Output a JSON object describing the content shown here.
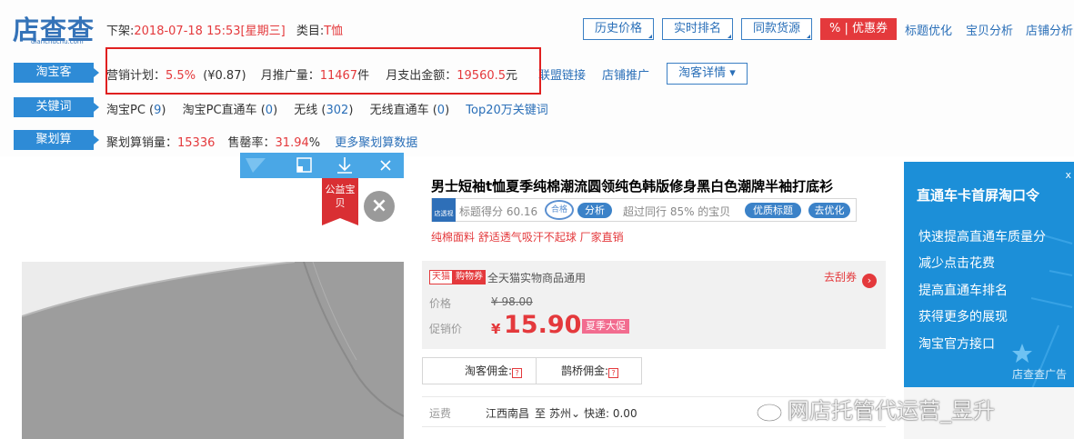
{
  "header": {
    "logo_text": "店查查",
    "logo_sub": "dianchuchu.com",
    "delist_label": "下架:",
    "delist_time": "2018-07-18 15:53[星期三]",
    "category_label": "类目:",
    "category_value": "T恤",
    "buttons": [
      "历史价格",
      "实时排名",
      "同款货源"
    ],
    "coupon_label": "% | 优惠券",
    "links": [
      "标题优化",
      "宝贝分析",
      "店铺分析"
    ]
  },
  "rows": {
    "taobaoke": {
      "label": "淘宝客",
      "plan_label": "营销计划：",
      "plan_value": "5.5%",
      "plan_amount": "(¥0.87)",
      "promo_label": "月推广量：",
      "promo_value": "11467",
      "promo_unit": "件",
      "spend_label": "月支出金额：",
      "spend_value": "19560.5",
      "spend_unit": "元",
      "link1": "联盟链接",
      "link2": "店铺推广",
      "detail_btn": "淘客详情 ▾"
    },
    "keywords": {
      "label": "关键词",
      "items": [
        {
          "name": "淘宝PC",
          "count": "9"
        },
        {
          "name": "淘宝PC直通车",
          "count": "0"
        },
        {
          "name": "无线",
          "count": "302"
        },
        {
          "name": "无线直通车",
          "count": "0"
        }
      ],
      "top_link": "Top20万关键词"
    },
    "juhuasuan": {
      "label": "聚划算",
      "sales_label": "聚划算销量：",
      "sales_value": "15336",
      "rate_label": "售罄率：",
      "rate_value": "31.94",
      "rate_unit": "%",
      "more_link": "更多聚划算数据"
    }
  },
  "ribbon": "公益宝贝",
  "product": {
    "title": "男士短袖t恤夏季纯棉潮流圆领纯色韩版修身黑白色潮牌半袖打底衫",
    "tool_logo": "店透视",
    "score_text": "标题得分 60.16",
    "seal_text": "合格",
    "analyze_btn": "分析",
    "exceed_text": "超过同行 85% 的宝贝",
    "quality_btn": "优质标题",
    "optimize_btn": "去优化",
    "subtitle": "纯棉面料 舒适透气吸汗不起球 厂家直销",
    "tmall_tag": "天猫",
    "coupon_tag": "购物券",
    "coupon_desc": "全天猫实物商品通用",
    "grab_label": "去刮券",
    "price_label": "价格",
    "orig_price": "¥ 98.00",
    "promo_label": "促销价",
    "promo_currency": "¥",
    "promo_price": "15.90",
    "promo_tag": "夏季大促",
    "taoke_commission": "淘客佣金:",
    "queqiao_commission": "鹊桥佣金:",
    "ship_label": "运费",
    "ship_from": "江西南昌",
    "ship_to_label": "至",
    "ship_to": "苏州",
    "ship_cost": "快递: 0.00"
  },
  "ad": {
    "headline": "直通车卡首屏淘口令",
    "items": [
      "快速提高直通车质量分",
      "减少点击花费",
      "提高直通车排名",
      "获得更多的展现",
      "淘宝官方接口"
    ],
    "close": "x",
    "footer": "店查查广告"
  },
  "watermark": "网店托管代运营_昱升"
}
